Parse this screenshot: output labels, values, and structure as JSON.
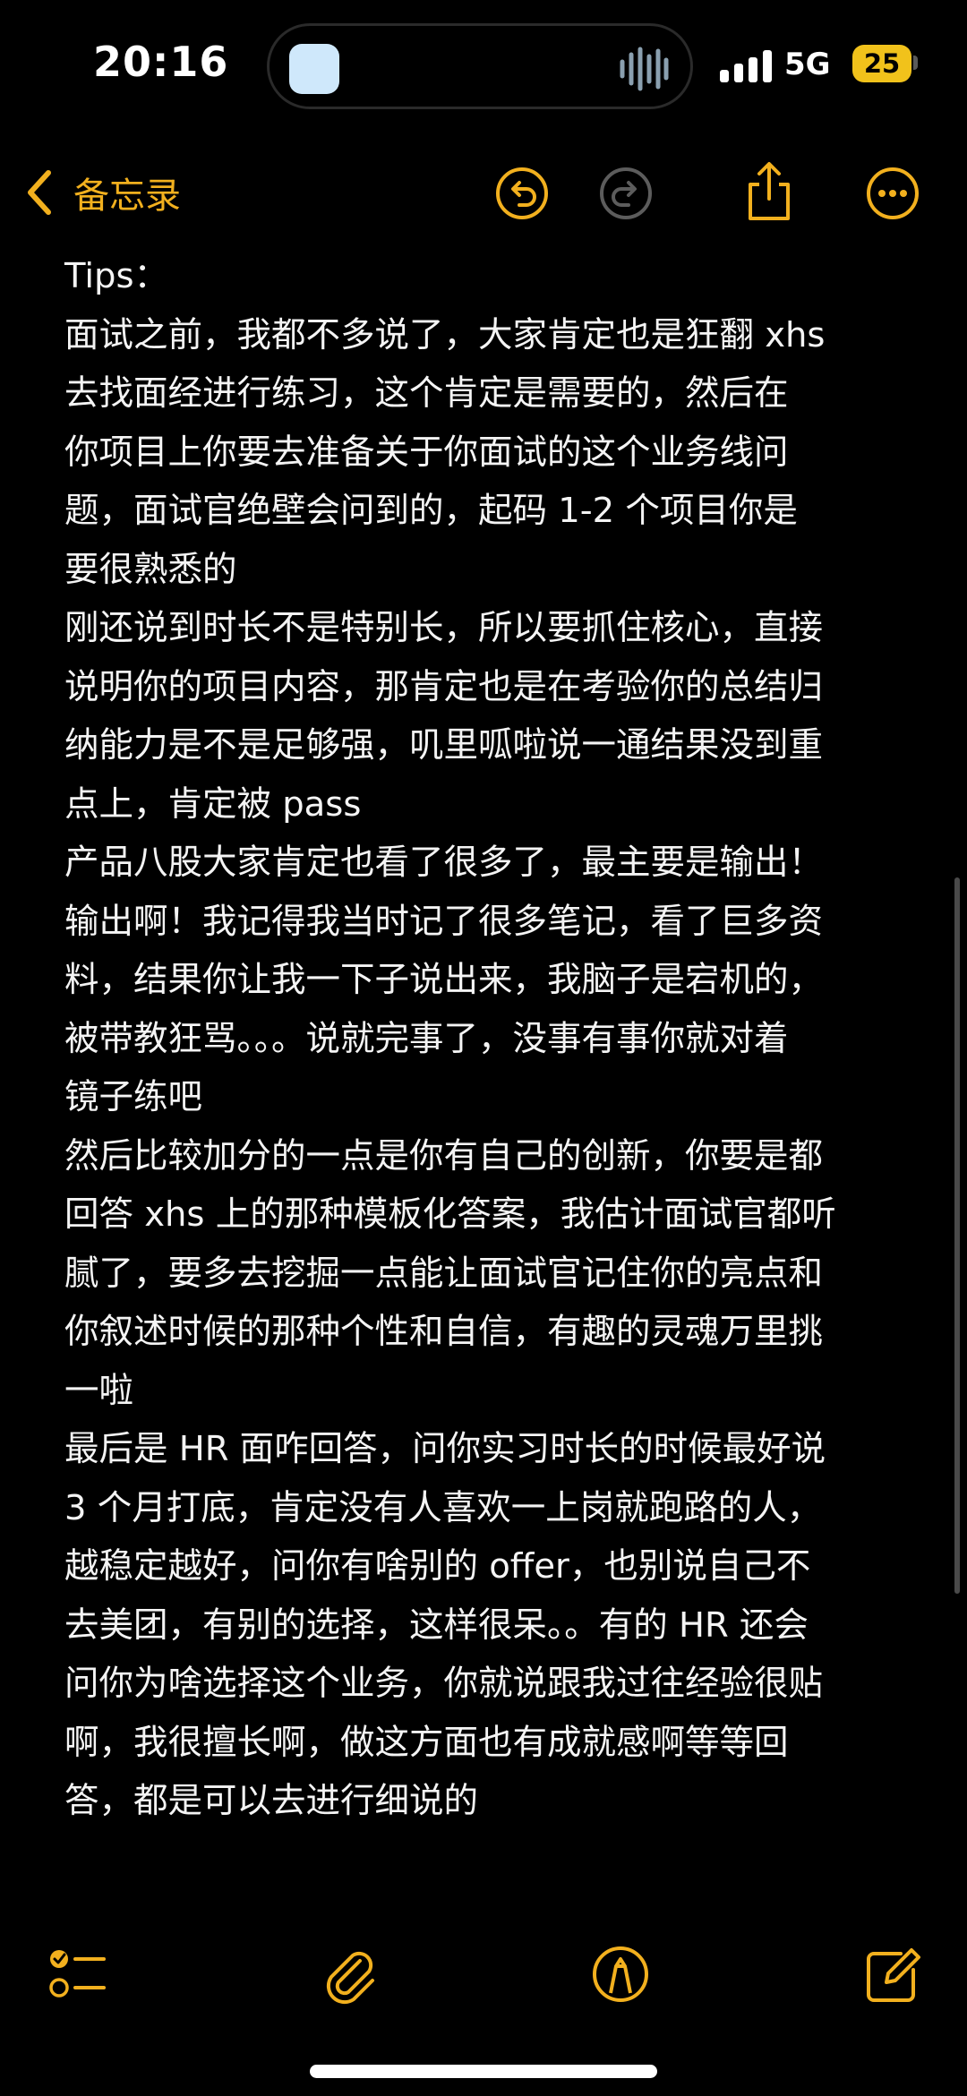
{
  "status_bar": {
    "time": "20:16",
    "network": "5G",
    "battery": "25"
  },
  "nav": {
    "back_label": "备忘录",
    "accent_color": "#f2b01e"
  },
  "note": {
    "lines": [
      "Tips：",
      "面试之前，我都不多说了，大家肯定也是狂翻 xhs",
      "去找面经进行练习，这个肯定是需要的，然后在",
      "你项目上你要去准备关于你面试的这个业务线问",
      "题，面试官绝壁会问到的，起码 1-2 个项目你是",
      "要很熟悉的",
      "刚还说到时长不是特别长，所以要抓住核心，直接",
      "说明你的项目内容，那肯定也是在考验你的总结归",
      "纳能力是不是足够强，叽里呱啦说一通结果没到重",
      "点上，肯定被 pass",
      "产品八股大家肯定也看了很多了，最主要是输出！",
      "输出啊！我记得我当时记了很多笔记，看了巨多资",
      "料，结果你让我一下子说出来，我脑子是宕机的，",
      "被带教狂骂。。。说就完事了，没事有事你就对着",
      "镜子练吧",
      "然后比较加分的一点是你有自己的创新，你要是都",
      "回答 xhs 上的那种模板化答案，我估计面试官都听",
      "腻了，要多去挖掘一点能让面试官记住你的亮点和",
      "你叙述时候的那种个性和自信，有趣的灵魂万里挑",
      "一啦",
      "最后是 HR 面咋回答，问你实习时长的时候最好说",
      "3 个月打底，肯定没有人喜欢一上岗就跑路的人，",
      "越稳定越好，问你有啥别的 offer，也别说自己不",
      "去美团，有别的选择，这样很呆。。有的 HR 还会",
      "问你为啥选择这个业务，你就说跟我过往经验很贴",
      "啊，我很擅长啊，做这方面也有成就感啊等等回",
      "答，都是可以去进行细说的"
    ]
  },
  "icons": {
    "undo": "undo-icon",
    "redo": "redo-icon",
    "share": "share-icon",
    "more": "more-icon",
    "checklist": "checklist-icon",
    "attach": "paperclip-icon",
    "markup": "pen-markup-icon",
    "compose": "compose-icon"
  }
}
